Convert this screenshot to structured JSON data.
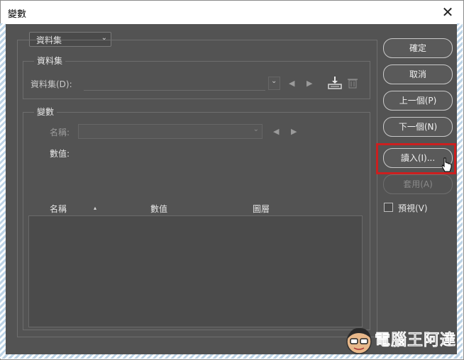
{
  "window": {
    "title": "變數",
    "close_glyph": "✕"
  },
  "top_dropdown": {
    "value": "資料集"
  },
  "dataset_group": {
    "legend": "資料集",
    "field_label": "資料集(D):"
  },
  "variable_group": {
    "legend": "變數",
    "name_label": "名稱:",
    "value_label": "數值:"
  },
  "table": {
    "columns": [
      "名稱",
      "數值",
      "圖層"
    ],
    "sort_indicator": "▴"
  },
  "buttons": {
    "ok": "確定",
    "cancel": "取消",
    "prev": "上一個(P)",
    "next": "下一個(N)",
    "import": "讀入(I)...",
    "apply": "套用(A)"
  },
  "preview": {
    "label": "預視(V)",
    "checked": false
  },
  "watermark": {
    "text": "電腦王阿達",
    "url": "http://www.kocpc.com.tw"
  },
  "colors": {
    "highlight": "#cc1f1f",
    "panel_bg": "#535353"
  }
}
